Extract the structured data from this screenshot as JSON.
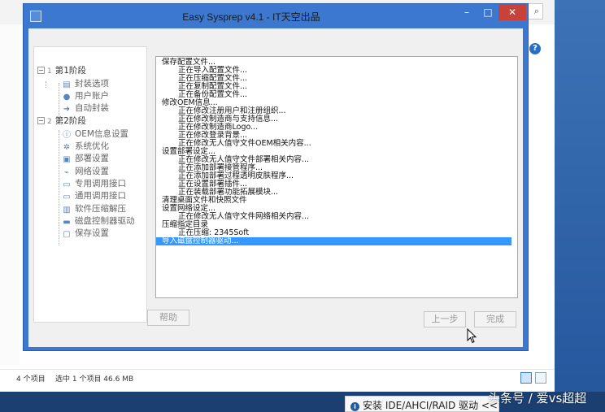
{
  "window": {
    "title": "Easy Sysprep v4.1 - IT天空出品",
    "minimize": "–",
    "maximize": "□",
    "close": "✕"
  },
  "tree": {
    "stage1": {
      "num": "1",
      "label": "第1阶段"
    },
    "stage1_items": [
      "封装选项",
      "用户账户",
      "自动封装"
    ],
    "stage2": {
      "num": "2",
      "label": "第2阶段"
    },
    "stage2_items": [
      "OEM信息设置",
      "系统优化",
      "部署设置",
      "网络设置",
      "专用调用接口",
      "通用调用接口",
      "软件压缩解压",
      "磁盘控制器驱动",
      "保存设置"
    ]
  },
  "log": [
    {
      "text": "保存配置文件...",
      "level": 0
    },
    {
      "text": "正在导入配置文件...",
      "level": 1
    },
    {
      "text": "正在压缩配置文件...",
      "level": 1
    },
    {
      "text": "正在复制配置文件...",
      "level": 1
    },
    {
      "text": "正在备份配置文件...",
      "level": 1
    },
    {
      "text": "修改OEM信息...",
      "level": 0
    },
    {
      "text": "正在修改注册用户和注册组织...",
      "level": 1
    },
    {
      "text": "正在修改制造商与支持信息...",
      "level": 1
    },
    {
      "text": "正在修改制造商Logo...",
      "level": 1
    },
    {
      "text": "正在修改登录背景...",
      "level": 1
    },
    {
      "text": "正在修改无人值守文件OEM相关内容...",
      "level": 1
    },
    {
      "text": "设置部署设定...",
      "level": 0
    },
    {
      "text": "正在修改无人值守文件部署相关内容...",
      "level": 1
    },
    {
      "text": "正在添加部署接管程序...",
      "level": 1
    },
    {
      "text": "正在添加部署过程透明皮肤程序...",
      "level": 1
    },
    {
      "text": "正在设置部署插件...",
      "level": 1
    },
    {
      "text": "正在装载部署功能拓展模块...",
      "level": 1
    },
    {
      "text": "清理桌面文件和快照文件",
      "level": 0
    },
    {
      "text": "设置网络设定...",
      "level": 0
    },
    {
      "text": "正在修改无人值守文件网络相关内容...",
      "level": 1
    },
    {
      "text": "压缩指定目录",
      "level": 0
    },
    {
      "text": "正在压缩: 2345Soft",
      "level": 1
    },
    {
      "text": "导入磁盘控制器驱动...",
      "level": 0,
      "selected": true
    }
  ],
  "buttons": {
    "help": "帮助",
    "prev": "上一步",
    "finish": "完成"
  },
  "explorer": {
    "item_count": "4 个项目",
    "selected_info": "选中 1 个项目  46.6 MB"
  },
  "toast": {
    "text": "安装 IDE/AHCI/RAID 驱动 <<"
  },
  "watermark": "头条号 / 爱vs超超",
  "colors": {
    "titlebar": "#3c78cf",
    "close": "#c7423a",
    "selection": "#3399ff"
  }
}
